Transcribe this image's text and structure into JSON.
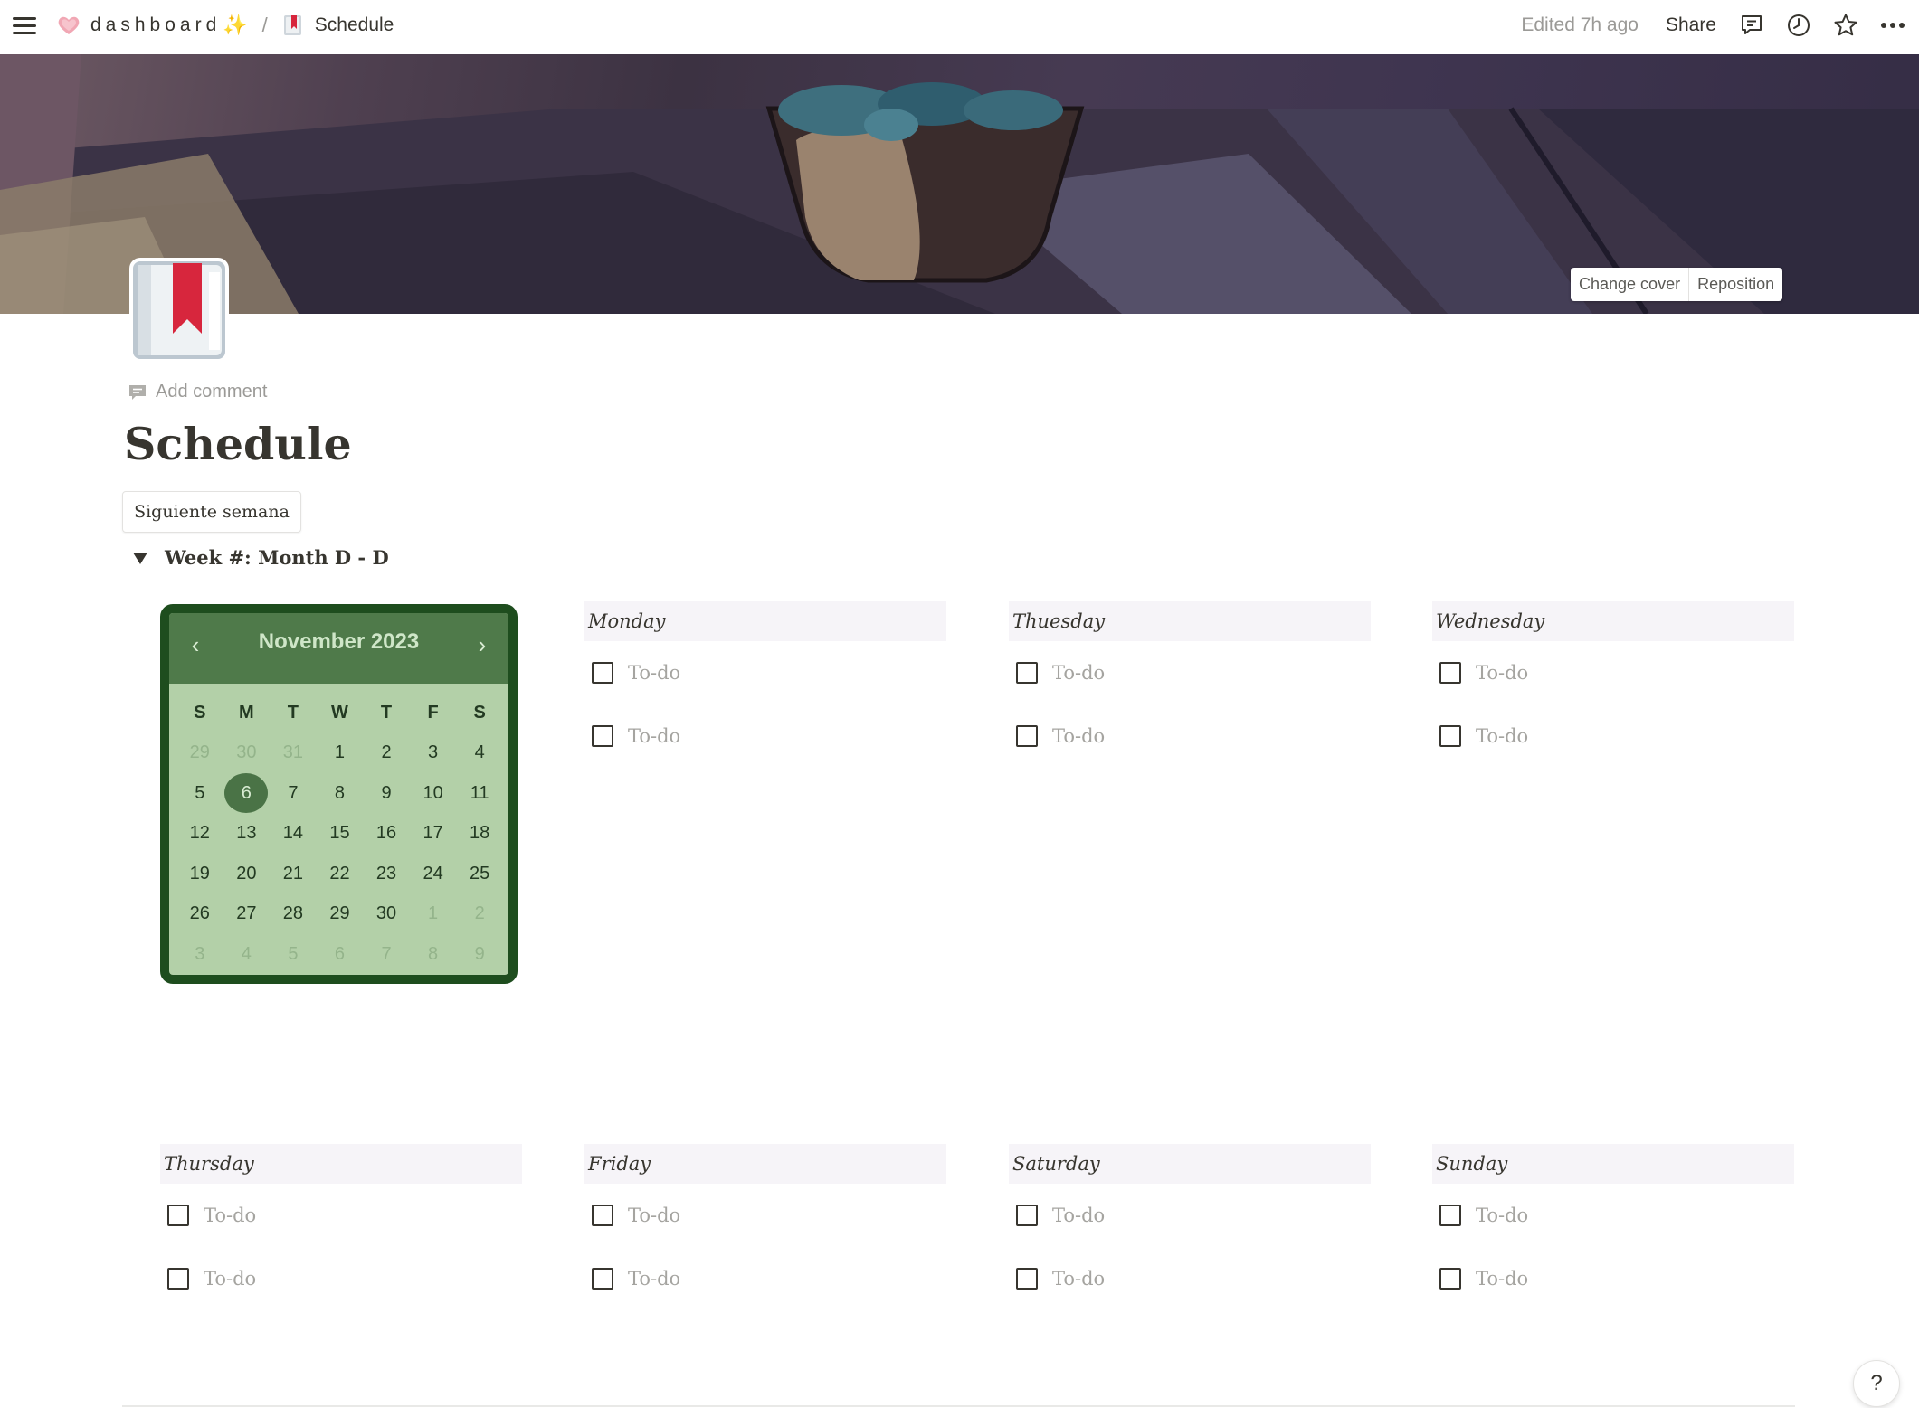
{
  "breadcrumb": {
    "workspace": "dashboard",
    "workspace_icon": "heart-icon",
    "workspace_suffix_icon": "sparkle-icon",
    "separator": "/",
    "page": "Schedule",
    "page_icon": "bookmark-book-icon"
  },
  "topbar": {
    "edited": "Edited 7h ago",
    "share": "Share",
    "icons": [
      "comments-icon",
      "history-clock-icon",
      "favorite-star-icon",
      "more-icon"
    ]
  },
  "cover": {
    "change_cover": "Change cover",
    "reposition": "Reposition"
  },
  "page": {
    "add_comment": "Add comment",
    "title": "Schedule",
    "button": "Siguiente semana",
    "toggle_title": "Week #: Month D - D"
  },
  "calendar": {
    "month": "November 2023",
    "prev": "‹",
    "next": "›",
    "weekdays": [
      "S",
      "M",
      "T",
      "W",
      "T",
      "F",
      "S"
    ],
    "weeks": [
      [
        "29",
        "30",
        "31",
        "1",
        "2",
        "3",
        "4"
      ],
      [
        "5",
        "6",
        "7",
        "8",
        "9",
        "10",
        "11"
      ],
      [
        "12",
        "13",
        "14",
        "15",
        "16",
        "17",
        "18"
      ],
      [
        "19",
        "20",
        "21",
        "22",
        "23",
        "24",
        "25"
      ],
      [
        "26",
        "27",
        "28",
        "29",
        "30",
        "1",
        "2"
      ],
      [
        "3",
        "4",
        "5",
        "6",
        "7",
        "8",
        "9"
      ]
    ],
    "selected": "6",
    "accent_color": "#4f7a4a",
    "frame_color": "#1e4d1e"
  },
  "days": {
    "monday": {
      "name": "Monday",
      "todos": [
        "To-do",
        "To-do"
      ]
    },
    "tuesday": {
      "name": "Thuesday",
      "todos": [
        "To-do",
        "To-do"
      ]
    },
    "wednesday": {
      "name": "Wednesday",
      "todos": [
        "To-do",
        "To-do"
      ]
    },
    "thursday": {
      "name": "Thursday",
      "todos": [
        "To-do",
        "To-do"
      ]
    },
    "friday": {
      "name": "Friday",
      "todos": [
        "To-do",
        "To-do"
      ]
    },
    "saturday": {
      "name": "Saturday",
      "todos": [
        "To-do",
        "To-do"
      ]
    },
    "sunday": {
      "name": "Sunday",
      "todos": [
        "To-do",
        "To-do"
      ]
    }
  },
  "help": "?"
}
